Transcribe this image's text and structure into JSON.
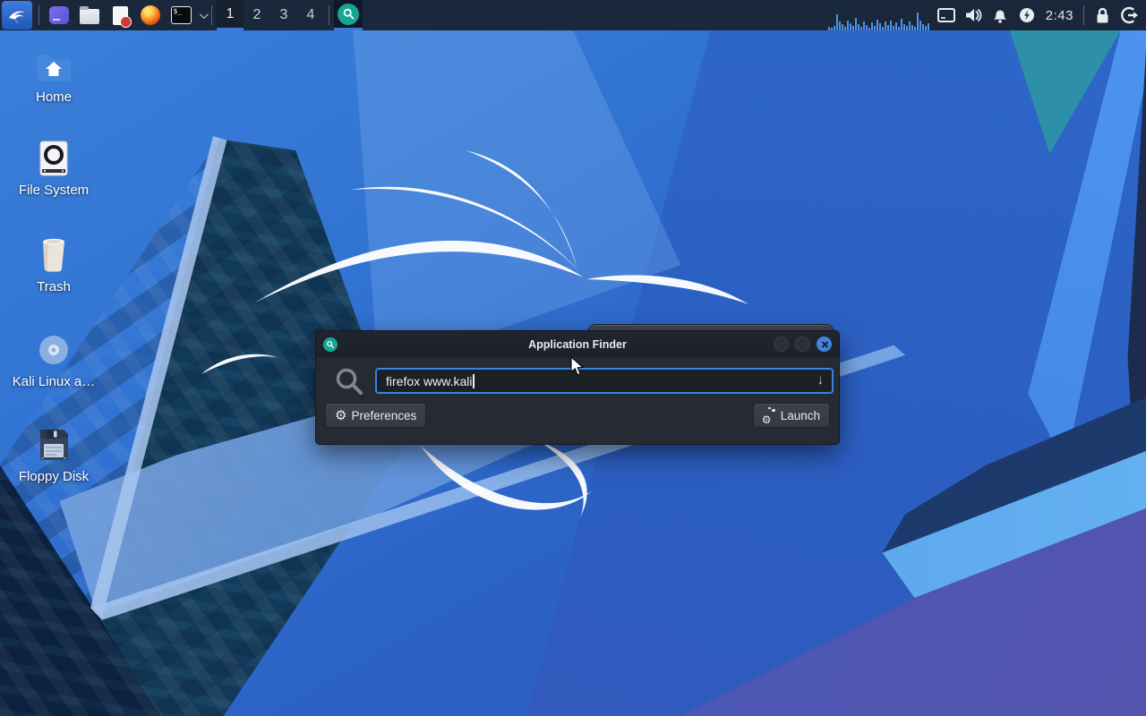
{
  "panel": {
    "launcher_icons": [
      "kali-menu",
      "window-app",
      "file-manager",
      "text-editor",
      "firefox",
      "terminal"
    ],
    "workspaces": [
      "1",
      "2",
      "3",
      "4"
    ],
    "active_workspace": "1",
    "clock": "2:43",
    "tray_icons": [
      "cpu-graph",
      "display",
      "volume",
      "notifications",
      "power-manager",
      "lock-screen",
      "logout"
    ]
  },
  "desktop": {
    "icons": [
      {
        "label": "Home"
      },
      {
        "label": "File System"
      },
      {
        "label": "Trash"
      },
      {
        "label": "Kali Linux a…"
      },
      {
        "label": "Floppy Disk"
      }
    ]
  },
  "app_finder": {
    "title": "Application Finder",
    "search_value": "firefox www.kali",
    "dropdown_arrow": "↓",
    "preferences_label": "Preferences",
    "launch_label": "Launch",
    "gear_glyph": "⚙"
  },
  "colors": {
    "accent": "#3584e4",
    "panel_bg": "#1a2536",
    "dialog_bg": "#262b33",
    "teal_icon": "#17a694"
  }
}
